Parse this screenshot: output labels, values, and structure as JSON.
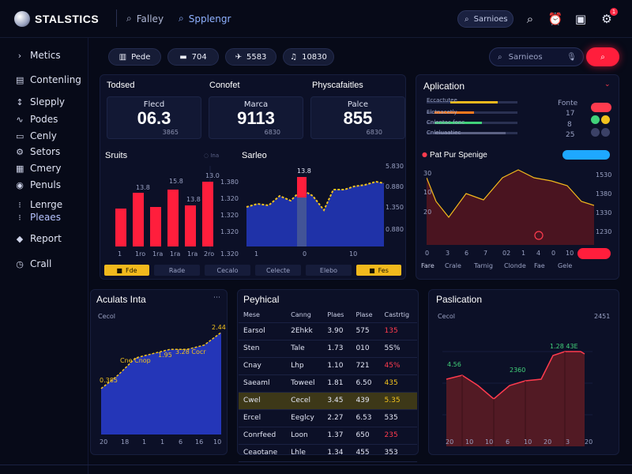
{
  "app": {
    "title": "STALSTICS"
  },
  "topnav": {
    "search1": "Falley",
    "search2": "Spplengr",
    "search_pill": "Sarnioes",
    "notif_count": "1"
  },
  "sidebar": {
    "items": [
      {
        "label": "Metics",
        "icon": "chevron-icon"
      },
      {
        "label": "Contenling",
        "icon": "grid-icon"
      },
      {
        "label": "Slepply",
        "icon": "bar-icon"
      },
      {
        "label": "Podes",
        "icon": "link-icon"
      },
      {
        "label": "Cenly",
        "icon": "doc-icon"
      },
      {
        "label": "Setors",
        "icon": "settings-icon"
      },
      {
        "label": "Cmery",
        "icon": "grid-icon"
      },
      {
        "label": "Penuls",
        "icon": "globe-icon"
      },
      {
        "label": "Lenrge",
        "icon": "list-icon"
      },
      {
        "label": "Pleaes",
        "icon": "list-icon"
      },
      {
        "label": "Report",
        "icon": "report-icon"
      },
      {
        "label": "Crall",
        "icon": "clock-icon"
      }
    ]
  },
  "toolbar": {
    "chips": [
      "Pede",
      "704",
      "5583",
      "10830"
    ],
    "search_placeholder": "Sarnieos"
  },
  "overview": {
    "label1": "Todsed",
    "label2": "Conofet",
    "label3": "Physcafaitles",
    "cards": [
      {
        "label": "Flecd",
        "value": "06.3",
        "sub": "3865"
      },
      {
        "label": "Marca",
        "value": "9113",
        "sub": "6830"
      },
      {
        "label": "Palce",
        "value": "855",
        "sub": "6830"
      }
    ],
    "chart1_title": "Sruits",
    "chart1_hint": "Ina",
    "chart2_title": "Sarleo",
    "bar_labels": [
      "13.8",
      "15.8",
      "13.8",
      "13.0"
    ],
    "bar_right_ticks": [
      "1.380",
      "1.320",
      "1.320",
      "1.320",
      "1.320"
    ],
    "bar_x_ticks": [
      "1",
      "1ro",
      "1ra",
      "1ra",
      "1ra",
      "2ro"
    ],
    "area_top_label": "13.8",
    "area_right_ticks": [
      "5.830",
      "0.880",
      "1.350",
      "0.880"
    ],
    "area_x_ticks": [
      "1",
      "0",
      "10"
    ],
    "tab_buttons": [
      "Fde",
      "Rade",
      "Cecalo",
      "Celecte",
      "Elebo",
      "Fes"
    ]
  },
  "activation": {
    "title": "Aplication",
    "rows": [
      {
        "label": "Eccactutee",
        "value": "Fonte",
        "color": "#ff3b4e"
      },
      {
        "label": "Elctnacetly",
        "value": "17",
        "color": "#41d17a"
      },
      {
        "label": "Cnlentac fonc",
        "value": "8",
        "color": "#c7ce2a"
      },
      {
        "label": "Cnleluaatiec",
        "value": "25",
        "color": "#5c6284"
      }
    ],
    "chart_title": "Pat Pur Spenige",
    "chart_right_ticks": [
      "1530",
      "1380",
      "1330",
      "1380",
      "1230"
    ],
    "chart_x_ticks": [
      "0",
      "3",
      "6",
      "7",
      "02",
      "1",
      "4",
      "0",
      "10"
    ],
    "chart_x_labels": [
      "Fare",
      "Crale",
      "Tarnig",
      "Clonde",
      "Fae",
      "Gele"
    ],
    "chart_left_ticks": [
      "30",
      "10",
      "20"
    ]
  },
  "analysis": {
    "title": "Aculats Inta",
    "subtitle": "Cecol",
    "points": [
      {
        "x": 0,
        "y": 204
      },
      {
        "x": 1,
        "y": 220
      },
      {
        "x": 2,
        "y": 240
      },
      {
        "x": 3,
        "y": 245
      },
      {
        "x": 4,
        "y": 250
      },
      {
        "x": 5,
        "y": 250
      },
      {
        "x": 6,
        "y": 255
      },
      {
        "x": 7,
        "y": 270
      }
    ],
    "labels": [
      "Cne Cnop",
      "1.95",
      "0.385",
      "3.28 Cocr",
      "1.94",
      "2.44"
    ],
    "x_ticks": [
      "20",
      "18",
      "1",
      "1",
      "6",
      "16",
      "10"
    ]
  },
  "physical": {
    "title": "Peyhical",
    "columns": [
      "Mese",
      "Canng",
      "Plaes",
      "Plase",
      "Castrtig"
    ],
    "rows": [
      [
        "Earsol",
        "2Ehkk",
        "3.90",
        "575",
        "135"
      ],
      [
        "Sten",
        "Tale",
        "1.73",
        "010",
        "5S%"
      ],
      [
        "Cnay",
        "Lhp",
        "1.10",
        "721",
        "45%"
      ],
      [
        "Saeaml",
        "Toweel",
        "1.81",
        "6.50",
        "435"
      ],
      [
        "Cwel",
        "Cecel",
        "3.45",
        "439",
        "5.35"
      ],
      [
        "Ercel",
        "Eeglcy",
        "2.27",
        "6.53",
        "535"
      ],
      [
        "Conrfeed",
        "Loon",
        "1.37",
        "650",
        "235"
      ],
      [
        "Ceaotane",
        "Lhle",
        "1.34",
        "455",
        "353"
      ]
    ],
    "highlight_row": 4,
    "colors": {
      "hi": "#ff3b4e",
      "mid": "#f2c21d",
      "low": "#e3e6f5"
    }
  },
  "publication": {
    "title": "Paslication",
    "subtitle": "Cecol",
    "labels": [
      "4.56",
      "2360",
      "1.28 43E",
      "2451"
    ],
    "x_ticks": [
      "20",
      "10",
      "10",
      "6",
      "10",
      "20",
      "3",
      "20"
    ]
  }
}
